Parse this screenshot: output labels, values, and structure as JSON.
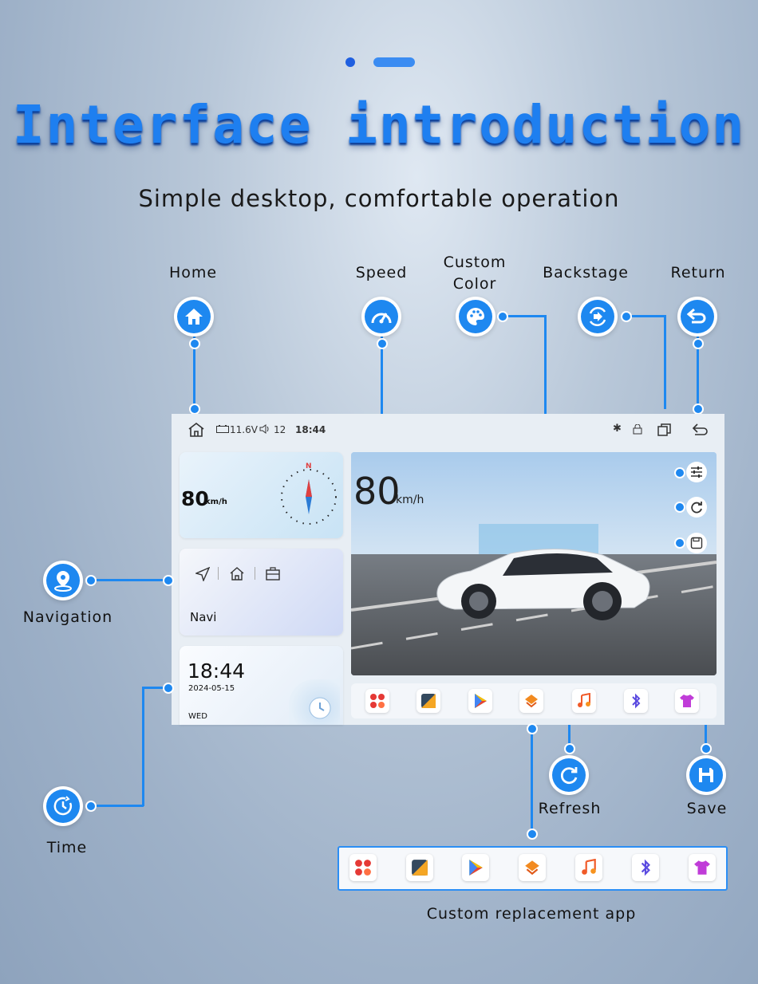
{
  "header": {
    "title": "Interface introduction",
    "subtitle": "Simple desktop, comfortable operation"
  },
  "callouts": {
    "home": "Home",
    "speed": "Speed",
    "custom_color_line1": "Custom",
    "custom_color_line2": "Color",
    "backstage": "Backstage",
    "return": "Return",
    "navigation": "Navigation",
    "time": "Time",
    "refresh": "Refresh",
    "save": "Save",
    "custom_app": "Custom replacement app"
  },
  "statusbar": {
    "voltage": "11.6V",
    "volume": "12",
    "clock": "18:44"
  },
  "speed_card": {
    "value": "80",
    "unit": "km/h",
    "compass_n": "N"
  },
  "navi_card": {
    "label": "Navi"
  },
  "time_card": {
    "time": "18:44",
    "date": "2024-05-15",
    "weekday": "WED"
  },
  "scene": {
    "speed": "80",
    "unit": "km/h"
  },
  "apps": [
    "apps-grid-icon",
    "wallpaper-icon",
    "play-store-icon",
    "theme-icon",
    "music-icon",
    "bluetooth-icon",
    "tshirt-icon"
  ],
  "colors": {
    "accent": "#1e88f0",
    "title": "#1e7ff0"
  }
}
